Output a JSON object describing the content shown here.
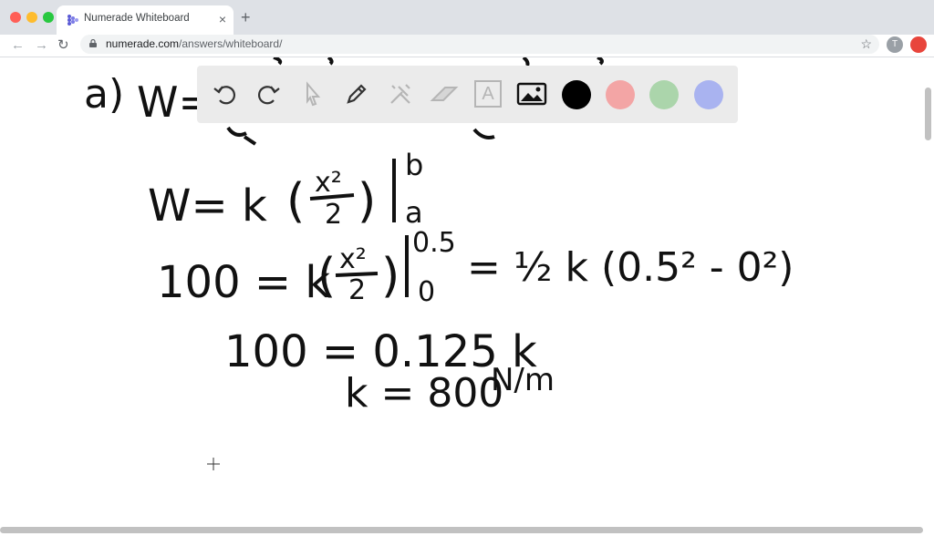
{
  "browser": {
    "tab_title": "Numerade Whiteboard",
    "tab_close": "×",
    "new_tab": "+",
    "url_domain": "numerade.com",
    "url_path": "/answers/whiteboard/",
    "back": "←",
    "forward": "→",
    "reload": "↻",
    "bookmark": "☆",
    "profile_initial": "T"
  },
  "whiteboard": {
    "tools": [
      "undo-icon",
      "redo-icon",
      "select-pointer-icon",
      "pen-icon",
      "tools-icon",
      "eraser-icon",
      "text-icon",
      "image-icon"
    ],
    "colors": [
      "#000000",
      "#f3a5a5",
      "#abd5ab",
      "#a9b3f0"
    ],
    "text_tool_label": "A",
    "handwriting": {
      "part_label": "a)",
      "line0": "W=",
      "line1_lhs": "W= k",
      "line1_frac_num": "x²",
      "line1_frac_den": "2",
      "line1_upper": "b",
      "line1_lower": "a",
      "line2_lhs": "100 = k",
      "line2_frac_num": "x²",
      "line2_frac_den": "2",
      "line2_upper": "0.5",
      "line2_lower": "0",
      "line2_rhs": "= ½ k (0.5² - 0²)",
      "line3": "100 = 0.125 k",
      "line4": "k = 800",
      "line4_unit": "N/m"
    }
  }
}
